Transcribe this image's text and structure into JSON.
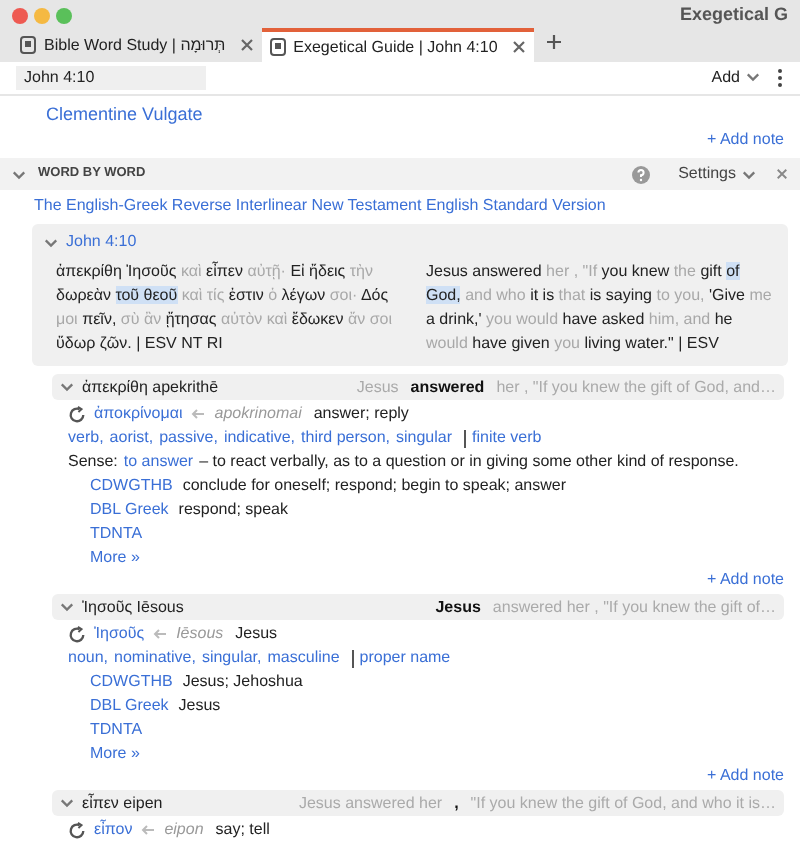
{
  "window": {
    "title": "Exegetical G"
  },
  "tabs": [
    {
      "label": "Bible Word Study | תְּרוּמָה",
      "selected": false
    },
    {
      "label": "Exegetical Guide | John 4:10",
      "selected": true
    }
  ],
  "toolbar": {
    "reference": "John 4:10",
    "add_menu": "Add"
  },
  "previous_section": {
    "link": "Clementine Vulgate",
    "add_note": "+ Add note"
  },
  "section": {
    "title": "WORD BY WORD",
    "expanded": true,
    "settings": "Settings",
    "source": "The English-Greek Reverse Interlinear New Testament English Standard Version",
    "verse": {
      "reference": "John 4:10",
      "expanded": true,
      "greek": [
        {
          "text": "ἀπεκρίθη Ἰησοῦς",
          "faded": false,
          "highlighted": false
        },
        {
          "text": "καὶ",
          "faded": true,
          "highlighted": false
        },
        {
          "text": "εἶπεν",
          "faded": false,
          "highlighted": false
        },
        {
          "text": "αὐτῇ·",
          "faded": true,
          "highlighted": false
        },
        {
          "text": "Εἰ ἤδεις",
          "faded": false,
          "highlighted": false
        },
        {
          "text": "τὴν",
          "faded": true,
          "highlighted": false
        },
        {
          "text": "δωρεὰν",
          "faded": false,
          "highlighted": false
        },
        {
          "text": "τοῦ θεοῦ",
          "faded": false,
          "highlighted": true
        },
        {
          "text": "καὶ τίς",
          "faded": true,
          "highlighted": false
        },
        {
          "text": "ἐστιν",
          "faded": false,
          "highlighted": false
        },
        {
          "text": "ὁ",
          "faded": true,
          "highlighted": false
        },
        {
          "text": "λέγων",
          "faded": false,
          "highlighted": false
        },
        {
          "text": "σοι·",
          "faded": true,
          "highlighted": false
        },
        {
          "text": "Δός",
          "faded": false,
          "highlighted": false
        },
        {
          "text": "μοι",
          "faded": true,
          "highlighted": false
        },
        {
          "text": "πεῖν,",
          "faded": false,
          "highlighted": false
        },
        {
          "text": "σὺ ἂν",
          "faded": true,
          "highlighted": false
        },
        {
          "text": "ᾔτησας",
          "faded": false,
          "highlighted": false
        },
        {
          "text": "αὐτὸν καὶ",
          "faded": true,
          "highlighted": false
        },
        {
          "text": "ἔδωκεν",
          "faded": false,
          "highlighted": false
        },
        {
          "text": "ἄν σοι",
          "faded": true,
          "highlighted": false
        },
        {
          "text": "ὕδωρ ζῶν.",
          "faded": false,
          "highlighted": false
        },
        {
          "text": "| ESV NT RI",
          "faded": false,
          "highlighted": false
        }
      ],
      "english": [
        {
          "text": "Jesus answered",
          "faded": false,
          "highlighted": false
        },
        {
          "text": "her , \"If",
          "faded": true,
          "highlighted": false
        },
        {
          "text": "you knew",
          "faded": false,
          "highlighted": false
        },
        {
          "text": "the",
          "faded": true,
          "highlighted": false
        },
        {
          "text": "gift",
          "faded": false,
          "highlighted": false
        },
        {
          "text": "of God,",
          "faded": false,
          "highlighted": true
        },
        {
          "text": "and who",
          "faded": true,
          "highlighted": false
        },
        {
          "text": "it is",
          "faded": false,
          "highlighted": false
        },
        {
          "text": "that",
          "faded": true,
          "highlighted": false
        },
        {
          "text": "is saying",
          "faded": false,
          "highlighted": false
        },
        {
          "text": "to you,",
          "faded": true,
          "highlighted": false
        },
        {
          "text": "'Give",
          "faded": false,
          "highlighted": false
        },
        {
          "text": "me",
          "faded": true,
          "highlighted": false
        },
        {
          "text": "a drink,'",
          "faded": false,
          "highlighted": false
        },
        {
          "text": "you would",
          "faded": true,
          "highlighted": false
        },
        {
          "text": "have asked",
          "faded": false,
          "highlighted": false
        },
        {
          "text": "him, and",
          "faded": true,
          "highlighted": false
        },
        {
          "text": "he",
          "faded": false,
          "highlighted": false
        },
        {
          "text": "would",
          "faded": true,
          "highlighted": false
        },
        {
          "text": "have given",
          "faded": false,
          "highlighted": false
        },
        {
          "text": "you",
          "faded": true,
          "highlighted": false
        },
        {
          "text": "living water.\"",
          "faded": false,
          "highlighted": false
        },
        {
          "text": "| ESV",
          "faded": false,
          "highlighted": false
        }
      ]
    },
    "entries": [
      {
        "headword": "ἀπεκρίθη apekrithē",
        "expanded": true,
        "context_before": "Jesus",
        "context_focus": "answered",
        "context_after": "her , \"If you knew the gift of God, and…",
        "lemma": "ἀποκρίνομαι",
        "transliteration": "apokrinomai",
        "gloss": "answer; reply",
        "morphology": [
          "verb,",
          "aorist,",
          "passive,",
          "indicative,",
          "third person,",
          "singular"
        ],
        "word_class": "finite verb",
        "sense_label": "Sense:",
        "sense_link": "to answer",
        "sense_text": "– to react verbally, as to a question or in giving some other kind of response.",
        "lexicons": [
          {
            "name": "CDWGTHB",
            "gloss": "conclude for oneself; respond; begin to speak; answer"
          },
          {
            "name": "DBL Greek",
            "gloss": "respond; speak"
          },
          {
            "name": "TDNTA"
          }
        ],
        "more": "More »",
        "add_note": "+ Add note"
      },
      {
        "headword": "Ἰησοῦς Iēsous",
        "expanded": true,
        "context_focus": "Jesus",
        "context_after": "answered her , \"If you knew the gift of…",
        "lemma": "Ἰησοῦς",
        "transliteration": "Iēsous",
        "gloss": "Jesus",
        "morphology": [
          "noun,",
          "nominative,",
          "singular,",
          "masculine"
        ],
        "word_class": "proper name",
        "lexicons": [
          {
            "name": "CDWGTHB",
            "gloss": "Jesus; Jehoshua"
          },
          {
            "name": "DBL Greek",
            "gloss": "Jesus"
          },
          {
            "name": "TDNTA"
          }
        ],
        "more": "More »",
        "add_note": "+ Add note"
      },
      {
        "headword": "εἶπεν eipen",
        "expanded": true,
        "context_before": "Jesus answered her",
        "context_focus": ",",
        "context_after": "\"If you knew the gift of God, and who it is…",
        "lemma": "εἶπον",
        "transliteration": "eipon",
        "gloss": "say; tell"
      }
    ]
  }
}
